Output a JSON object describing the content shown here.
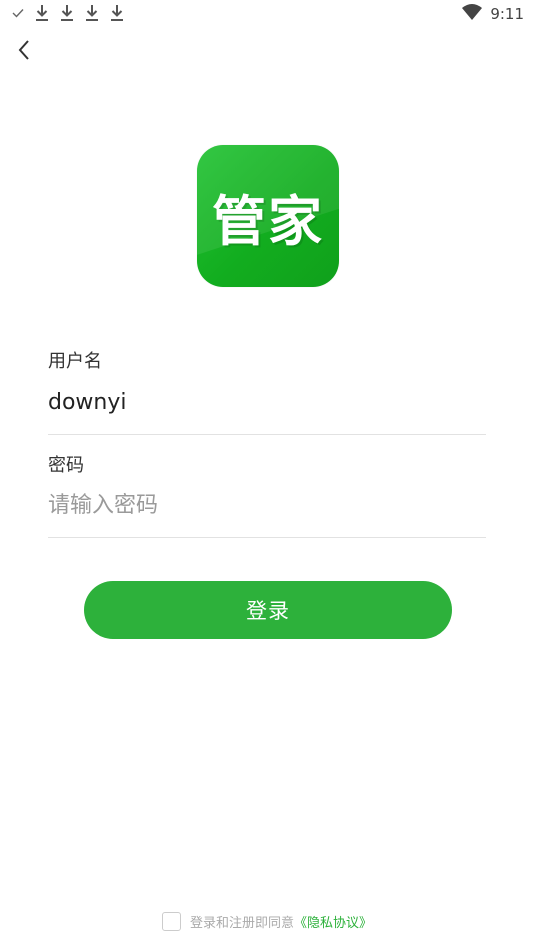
{
  "status_bar": {
    "time": "9:11",
    "icons": [
      "check-icon",
      "download-icon",
      "download-icon",
      "download-icon",
      "download-icon",
      "wifi-icon"
    ]
  },
  "logo": {
    "text": "管家",
    "color": "#1bb52a"
  },
  "form": {
    "username": {
      "label": "用户名",
      "value": "downyi"
    },
    "password": {
      "label": "密码",
      "placeholder": "请输入密码"
    },
    "login_button": "登录"
  },
  "agreement": {
    "text": "登录和注册即同意",
    "link": "《隐私协议》"
  },
  "colors": {
    "accent": "#2db13b"
  }
}
